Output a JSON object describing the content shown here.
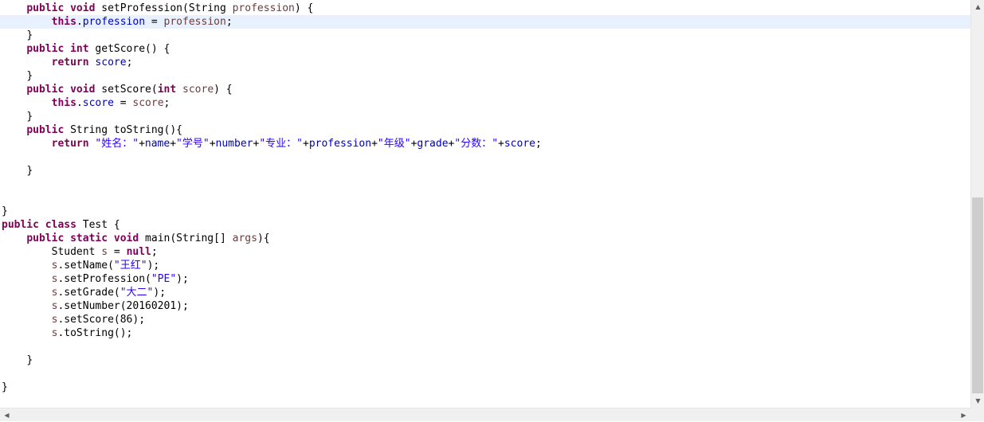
{
  "editor": {
    "current_line_index": 1,
    "lines": [
      [
        [
          "ws",
          "    "
        ],
        [
          "kw",
          "public"
        ],
        [
          "txt",
          " "
        ],
        [
          "kw",
          "void"
        ],
        [
          "txt",
          " setProfession(String "
        ],
        [
          "par",
          "profession"
        ],
        [
          "txt",
          ") {"
        ]
      ],
      [
        [
          "ws",
          "        "
        ],
        [
          "kw",
          "this"
        ],
        [
          "txt",
          "."
        ],
        [
          "fld",
          "profession"
        ],
        [
          "txt",
          " = "
        ],
        [
          "par",
          "profession"
        ],
        [
          "txt",
          ";"
        ]
      ],
      [
        [
          "ws",
          "    "
        ],
        [
          "txt",
          "}"
        ]
      ],
      [
        [
          "ws",
          "    "
        ],
        [
          "kw",
          "public"
        ],
        [
          "txt",
          " "
        ],
        [
          "kw",
          "int"
        ],
        [
          "txt",
          " getScore() {"
        ]
      ],
      [
        [
          "ws",
          "        "
        ],
        [
          "kw",
          "return"
        ],
        [
          "txt",
          " "
        ],
        [
          "fld",
          "score"
        ],
        [
          "txt",
          ";"
        ]
      ],
      [
        [
          "ws",
          "    "
        ],
        [
          "txt",
          "}"
        ]
      ],
      [
        [
          "ws",
          "    "
        ],
        [
          "kw",
          "public"
        ],
        [
          "txt",
          " "
        ],
        [
          "kw",
          "void"
        ],
        [
          "txt",
          " setScore("
        ],
        [
          "kw",
          "int"
        ],
        [
          "txt",
          " "
        ],
        [
          "par",
          "score"
        ],
        [
          "txt",
          ") {"
        ]
      ],
      [
        [
          "ws",
          "        "
        ],
        [
          "kw",
          "this"
        ],
        [
          "txt",
          "."
        ],
        [
          "fld",
          "score"
        ],
        [
          "txt",
          " = "
        ],
        [
          "par",
          "score"
        ],
        [
          "txt",
          ";"
        ]
      ],
      [
        [
          "ws",
          "    "
        ],
        [
          "txt",
          "}"
        ]
      ],
      [
        [
          "ws",
          "    "
        ],
        [
          "kw",
          "public"
        ],
        [
          "txt",
          " String toString(){"
        ]
      ],
      [
        [
          "ws",
          "        "
        ],
        [
          "kw",
          "return"
        ],
        [
          "txt",
          " "
        ],
        [
          "str",
          "\"姓名：\""
        ],
        [
          "txt",
          "+"
        ],
        [
          "fld",
          "name"
        ],
        [
          "txt",
          "+"
        ],
        [
          "str",
          "\"学号\""
        ],
        [
          "txt",
          "+"
        ],
        [
          "fld",
          "number"
        ],
        [
          "txt",
          "+"
        ],
        [
          "str",
          "\"专业：\""
        ],
        [
          "txt",
          "+"
        ],
        [
          "fld",
          "profession"
        ],
        [
          "txt",
          "+"
        ],
        [
          "str",
          "\"年级\""
        ],
        [
          "txt",
          "+"
        ],
        [
          "fld",
          "grade"
        ],
        [
          "txt",
          "+"
        ],
        [
          "str",
          "\"分数：\""
        ],
        [
          "txt",
          "+"
        ],
        [
          "fld",
          "score"
        ],
        [
          "txt",
          ";"
        ]
      ],
      [
        [
          "ws",
          ""
        ]
      ],
      [
        [
          "ws",
          "    "
        ],
        [
          "txt",
          "}"
        ]
      ],
      [
        [
          "ws",
          ""
        ]
      ],
      [
        [
          "ws",
          ""
        ]
      ],
      [
        [
          "txt",
          "}"
        ]
      ],
      [
        [
          "kw",
          "public"
        ],
        [
          "txt",
          " "
        ],
        [
          "kw",
          "class"
        ],
        [
          "txt",
          " Test {"
        ]
      ],
      [
        [
          "ws",
          "    "
        ],
        [
          "kw",
          "public"
        ],
        [
          "txt",
          " "
        ],
        [
          "kw",
          "static"
        ],
        [
          "txt",
          " "
        ],
        [
          "kw",
          "void"
        ],
        [
          "txt",
          " main(String[] "
        ],
        [
          "par",
          "args"
        ],
        [
          "txt",
          "){"
        ]
      ],
      [
        [
          "ws",
          "        "
        ],
        [
          "txt",
          "Student "
        ],
        [
          "par",
          "s"
        ],
        [
          "txt",
          " = "
        ],
        [
          "kw",
          "null"
        ],
        [
          "txt",
          ";"
        ]
      ],
      [
        [
          "ws",
          "        "
        ],
        [
          "par",
          "s"
        ],
        [
          "txt",
          ".setName("
        ],
        [
          "str",
          "\"王红\""
        ],
        [
          "txt",
          ");"
        ]
      ],
      [
        [
          "ws",
          "        "
        ],
        [
          "par",
          "s"
        ],
        [
          "txt",
          ".setProfession("
        ],
        [
          "str",
          "\"PE\""
        ],
        [
          "txt",
          ");"
        ]
      ],
      [
        [
          "ws",
          "        "
        ],
        [
          "par",
          "s"
        ],
        [
          "txt",
          ".setGrade("
        ],
        [
          "str",
          "\"大二\""
        ],
        [
          "txt",
          ");"
        ]
      ],
      [
        [
          "ws",
          "        "
        ],
        [
          "par",
          "s"
        ],
        [
          "txt",
          ".setNumber(20160201);"
        ]
      ],
      [
        [
          "ws",
          "        "
        ],
        [
          "par",
          "s"
        ],
        [
          "txt",
          ".setScore(86);"
        ]
      ],
      [
        [
          "ws",
          "        "
        ],
        [
          "par",
          "s"
        ],
        [
          "txt",
          ".toString();"
        ]
      ],
      [
        [
          "ws",
          ""
        ]
      ],
      [
        [
          "ws",
          "    "
        ],
        [
          "txt",
          "}"
        ]
      ],
      [
        [
          "ws",
          ""
        ]
      ],
      [
        [
          "txt",
          "}"
        ]
      ]
    ]
  },
  "scrollbars": {
    "vertical": {
      "up_arrow": "▲",
      "down_arrow": "▼",
      "position": 0.5
    },
    "horizontal": {
      "left_arrow": "◀",
      "right_arrow": "▶"
    }
  },
  "colors": {
    "keyword": "#7f0055",
    "field": "#0000c0",
    "string": "#2a00ff",
    "parameter": "#6a3e3e",
    "current_line": "#e8f2fe"
  },
  "icons": {
    "up": "scroll-up-arrow-icon",
    "down": "scroll-down-arrow-icon",
    "left": "scroll-left-arrow-icon",
    "right": "scroll-right-arrow-icon"
  }
}
